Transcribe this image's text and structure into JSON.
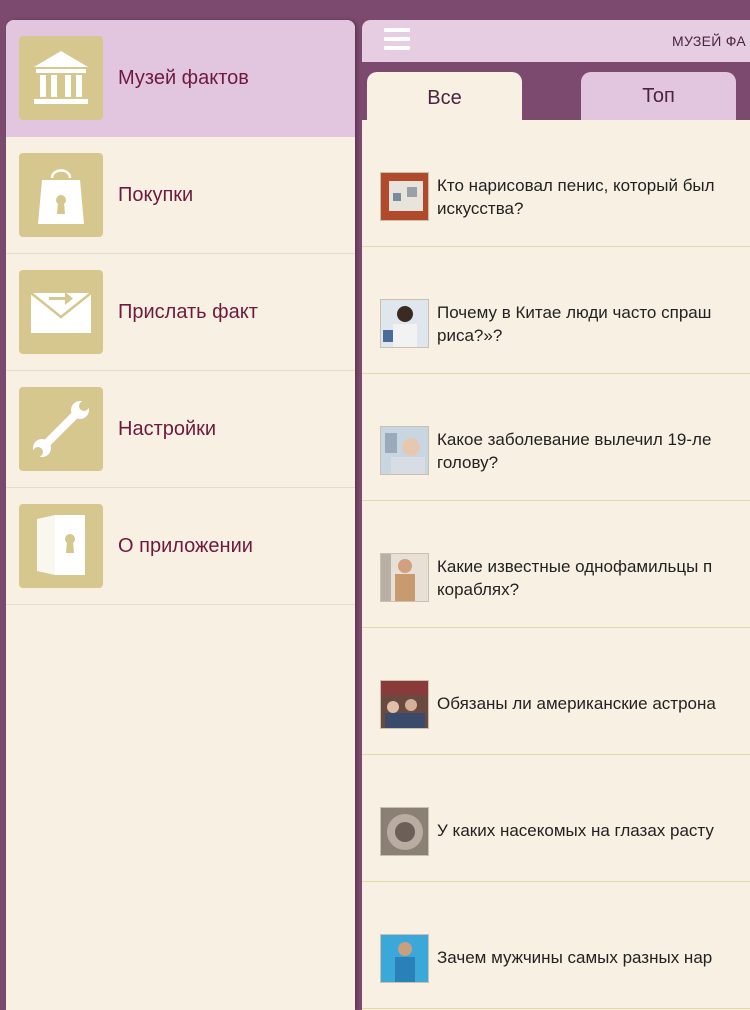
{
  "sidebar": {
    "items": [
      {
        "label": "Музей фактов",
        "icon": "museum-icon"
      },
      {
        "label": "Покупки",
        "icon": "shopping-bag-icon"
      },
      {
        "label": "Прислать факт",
        "icon": "envelope-icon"
      },
      {
        "label": "Настройки",
        "icon": "wrench-icon"
      },
      {
        "label": "О приложении",
        "icon": "book-icon"
      }
    ]
  },
  "header": {
    "title": "МУЗЕЙ ФА",
    "menu_icon": "hamburger-icon"
  },
  "tabs": [
    {
      "label": "Все"
    },
    {
      "label": "Топ"
    }
  ],
  "facts": [
    {
      "line1": "Кто нарисовал пенис, который был",
      "line2": "искусства?"
    },
    {
      "line1": "Почему в Китае люди часто спраш",
      "line2": "риса?»?"
    },
    {
      "line1": "Какое заболевание вылечил 19-ле",
      "line2": "голову?"
    },
    {
      "line1": "Какие известные однофамильцы п",
      "line2": "кораблях?"
    },
    {
      "line1": "Обязаны ли американские астрона",
      "line2": ""
    },
    {
      "line1": "У каких насекомых на глазах расту",
      "line2": ""
    },
    {
      "line1": "Зачем мужчины самых разных нар",
      "line2": ""
    }
  ],
  "colors": {
    "accent_purple": "#7b4a6e",
    "active_pink": "#e2c6df",
    "icon_gold": "#d6c78e",
    "cream": "#f8f1e3",
    "label_maroon": "#6e1a3f"
  }
}
